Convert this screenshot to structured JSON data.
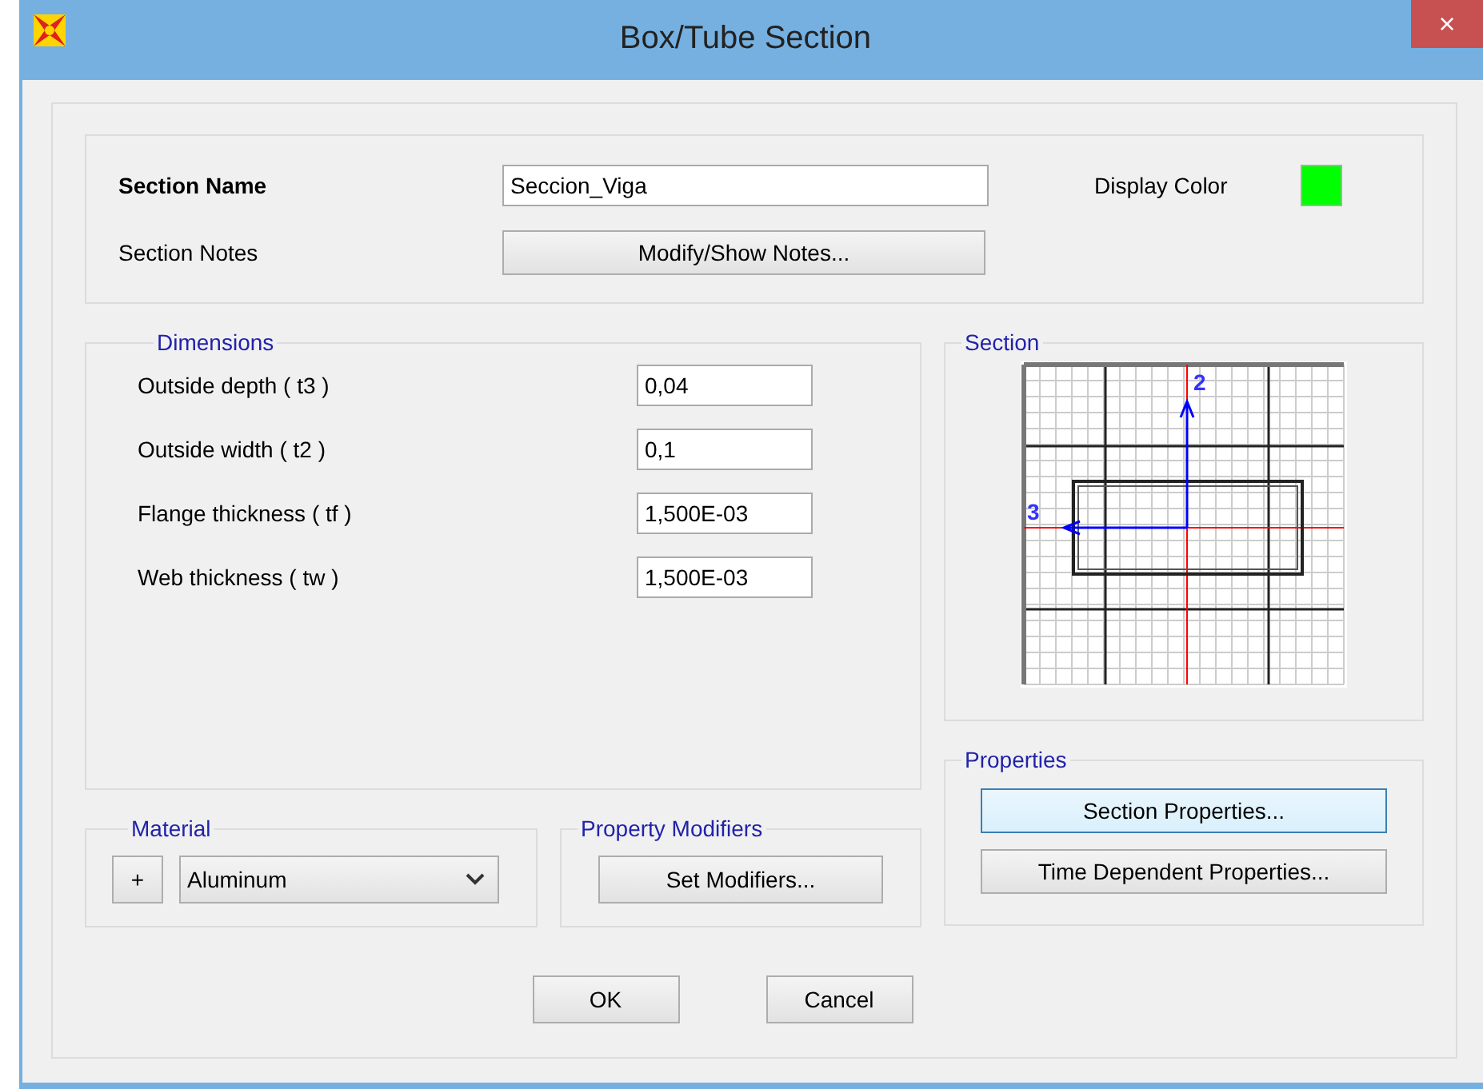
{
  "window": {
    "title": "Box/Tube Section",
    "close": "×"
  },
  "section_name": {
    "label": "Section Name",
    "value": "Seccion_Viga"
  },
  "display_color": {
    "label": "Display Color",
    "color": "#00ff00"
  },
  "section_notes": {
    "label": "Section Notes",
    "button": "Modify/Show Notes..."
  },
  "dimensions": {
    "title": "Dimensions",
    "rows": [
      {
        "label": "Outside depth  ( t3 )",
        "value": "0,04"
      },
      {
        "label": "Outside width  ( t2 )",
        "value": "0,1"
      },
      {
        "label": "Flange thickness  ( tf )",
        "value": "1,500E-03"
      },
      {
        "label": "Web thickness  ( tw )",
        "value": "1,500E-03"
      }
    ]
  },
  "section": {
    "title": "Section",
    "axis_labels": [
      "2",
      "3"
    ]
  },
  "material": {
    "title": "Material",
    "add_button": "+",
    "value": "Aluminum"
  },
  "property_modifiers": {
    "title": "Property Modifiers",
    "button": "Set Modifiers..."
  },
  "properties": {
    "title": "Properties",
    "buttons": [
      {
        "label": "Section Properties...",
        "selected": true
      },
      {
        "label": "Time Dependent Properties...",
        "selected": false
      }
    ]
  },
  "buttons": [
    "OK",
    "Cancel"
  ]
}
